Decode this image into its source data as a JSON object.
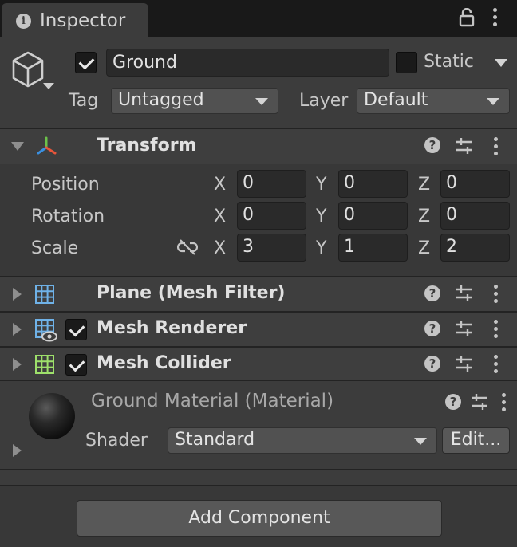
{
  "tab": {
    "title": "Inspector",
    "icon": "info-icon"
  },
  "object": {
    "active": true,
    "name": "Ground",
    "static_checked": false,
    "static_label": "Static",
    "tag_label": "Tag",
    "tag_value": "Untagged",
    "layer_label": "Layer",
    "layer_value": "Default"
  },
  "transform": {
    "title": "Transform",
    "rows": [
      {
        "label": "Position",
        "x": "0",
        "y": "0",
        "z": "0"
      },
      {
        "label": "Rotation",
        "x": "0",
        "y": "0",
        "z": "0"
      },
      {
        "label": "Scale",
        "x": "3",
        "y": "1",
        "z": "2"
      }
    ],
    "axis_labels": {
      "x": "X",
      "y": "Y",
      "z": "Z"
    }
  },
  "components": [
    {
      "title": "Plane (Mesh Filter)",
      "has_checkbox": false
    },
    {
      "title": "Mesh Renderer",
      "has_checkbox": true,
      "checked": true
    },
    {
      "title": "Mesh Collider",
      "has_checkbox": true,
      "checked": true
    }
  ],
  "material": {
    "title": "Ground Material (Material)",
    "shader_label": "Shader",
    "shader_value": "Standard",
    "edit_label": "Edit..."
  },
  "add_component_label": "Add Component",
  "colors": {
    "panel_bg": "#383838",
    "header_bg": "#3e3e3e",
    "field_bg": "#2a2a2a",
    "button_bg": "#585858",
    "text": "#d2d2d2"
  }
}
